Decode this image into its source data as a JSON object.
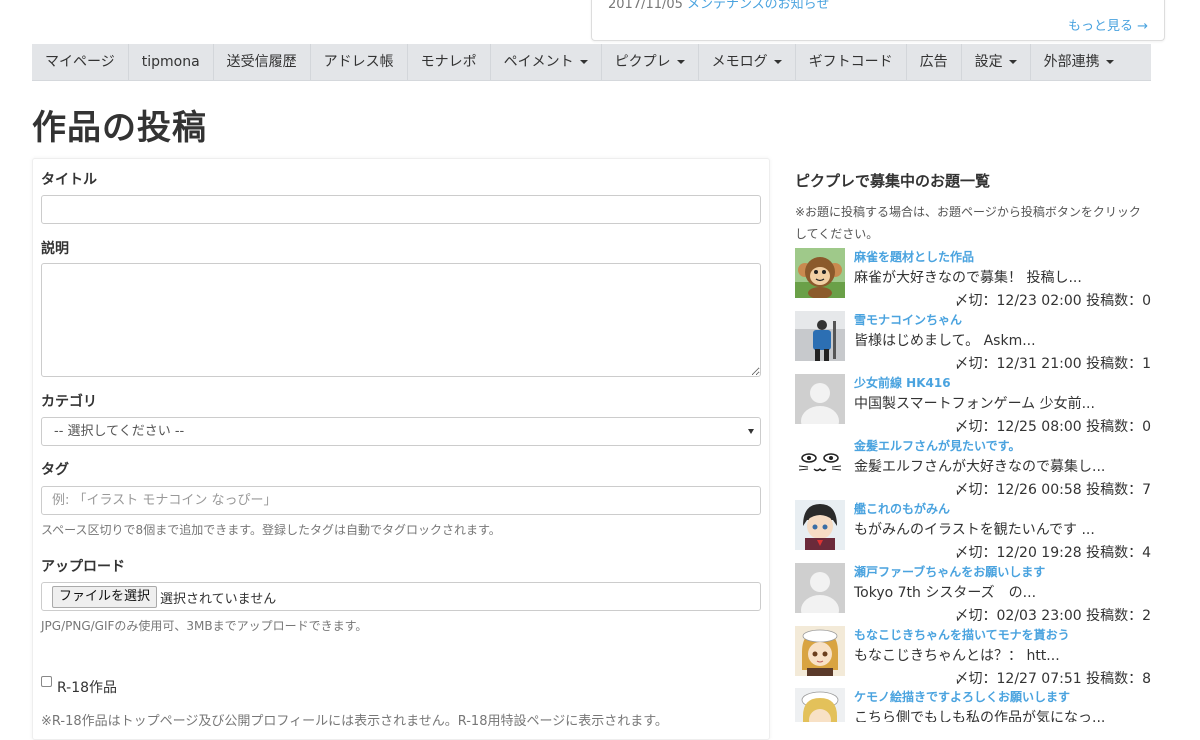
{
  "news": {
    "date": "2017/11/05",
    "link": "メンテナンスのお知らせ",
    "more": "もっと見る →"
  },
  "nav": [
    {
      "label": "マイページ",
      "dropdown": false
    },
    {
      "label": "tipmona",
      "dropdown": false
    },
    {
      "label": "送受信履歴",
      "dropdown": false
    },
    {
      "label": "アドレス帳",
      "dropdown": false
    },
    {
      "label": "モナレポ",
      "dropdown": false
    },
    {
      "label": "ペイメント",
      "dropdown": true
    },
    {
      "label": "ピクプレ",
      "dropdown": true
    },
    {
      "label": "メモログ",
      "dropdown": true
    },
    {
      "label": "ギフトコード",
      "dropdown": false
    },
    {
      "label": "広告",
      "dropdown": false
    },
    {
      "label": "設定",
      "dropdown": true
    },
    {
      "label": "外部連携",
      "dropdown": true
    }
  ],
  "page": {
    "title": "作品の投稿"
  },
  "form": {
    "title_label": "タイトル",
    "title_value": "",
    "desc_label": "説明",
    "desc_value": "",
    "category_label": "カテゴリ",
    "category_selected": "-- 選択してください --",
    "tag_label": "タグ",
    "tag_placeholder": "例: 「イラスト モナコイン なっぴー」",
    "tag_help": "スペース区切りで8個まで追加できます。登録したタグは自動でタグロックされます。",
    "upload_label": "アップロード",
    "file_button": "ファイルを選択",
    "file_status": "選択されていません",
    "upload_help": "JPG/PNG/GIFのみ使用可、3MBまでアップロードできます。",
    "r18_label": "R-18作品",
    "r18_checked": false,
    "r18_note": "※R-18作品はトップページ及び公開プロフィールには表示されません。R-18用特設ページに表示されます。"
  },
  "sidebar": {
    "title": "ピクプレで募集中のお題一覧",
    "note": "※お題に投稿する場合は、お題ページから投稿ボタンをクリックしてください。",
    "topics": [
      {
        "title": "麻雀を題材とした作品",
        "desc": "麻雀が大好きなので募集！ 投稿し...",
        "meta": "〆切：12/23 02:00 投稿数：0",
        "thumb": "monkey-avatar"
      },
      {
        "title": "雪モナコインちゃん",
        "desc": "皆様はじめまして。 Askm...",
        "meta": "〆切：12/31 21:00 投稿数：1",
        "thumb": "photo-person-avatar"
      },
      {
        "title": "少女前線 HK416",
        "desc": "中国製スマートフォンゲーム 少女前...",
        "meta": "〆切：12/25 08:00 投稿数：0",
        "thumb": "default-avatar"
      },
      {
        "title": "金髪エルフさんが見たいです。",
        "desc": "金髪エルフさんが大好きなので募集し...",
        "meta": "〆切：12/26 00:58 投稿数：7",
        "thumb": "cat-face-avatar"
      },
      {
        "title": "艦これのもがみん",
        "desc": "もがみんのイラストを観たいんです ...",
        "meta": "〆切：12/20 19:28 投稿数：4",
        "thumb": "anime-boy-avatar"
      },
      {
        "title": "瀬戸ファーブちゃんをお願いします",
        "desc": "Tokyo 7th シスターズ　の...",
        "meta": "〆切：02/03 23:00 投稿数：2",
        "thumb": "default-avatar"
      },
      {
        "title": "もなこじきちゃんを描いてモナを貰おう",
        "desc": "もなこじきちゃんとは？： htt...",
        "meta": "〆切：12/27 07:51 投稿数：8",
        "thumb": "anime-girl-avatar"
      },
      {
        "title": "ケモノ絵描きですよろしくお願いします",
        "desc": "こちら側でもしも私の作品が気になっ...",
        "meta": "",
        "thumb": "anime-girl-avatar"
      }
    ]
  }
}
